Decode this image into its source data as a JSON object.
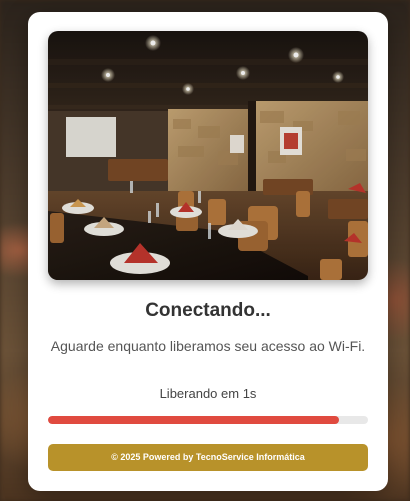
{
  "card": {
    "title": "Conectando...",
    "subtitle": "Aguarde enquanto liberamos seu acesso ao Wi-Fi.",
    "countdown": "Liberando em 1s",
    "progress": 0.91,
    "footer": "© 2025 Powered by TecnoService Informática"
  },
  "colors": {
    "progress_fill": "#e04a3f",
    "progress_track": "#e8e8e8",
    "footer_bg": "#b8922a",
    "card_bg": "#ffffff"
  }
}
